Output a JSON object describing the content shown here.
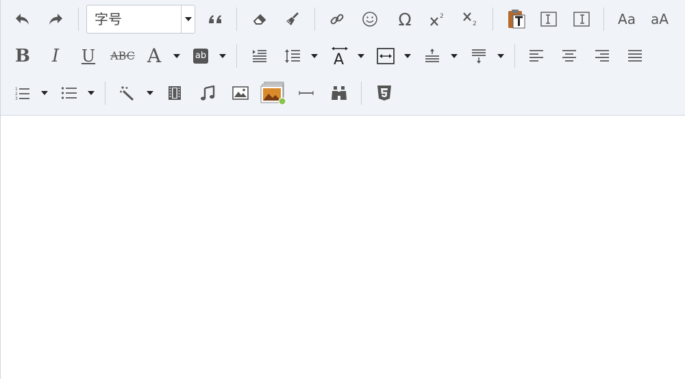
{
  "toolbar": {
    "font_size_select": {
      "value": "字号"
    },
    "row1": [
      "undo-icon",
      "redo-icon",
      "font-size-select",
      "blockquote-icon",
      "eraser-icon",
      "format-brush-icon",
      "link-icon",
      "emoji-icon",
      "special-char-icon",
      "superscript-icon",
      "subscript-icon",
      "paste-text-icon",
      "indent-left-box-icon",
      "indent-right-box-icon",
      "uppercase-icon",
      "lowercase-icon"
    ],
    "glyphs": {
      "bold": "B",
      "italic": "I",
      "underline": "U",
      "strikethrough": "ABC",
      "font_color": "A",
      "highlight": "ab",
      "special_char": "Ω",
      "upper_a": "Aa",
      "lower_a": "aA"
    }
  },
  "editor": {
    "content": ""
  },
  "colors": {
    "toolbar_bg": "#f0f4f9",
    "icon": "#555555",
    "border": "#d3d9e2"
  }
}
